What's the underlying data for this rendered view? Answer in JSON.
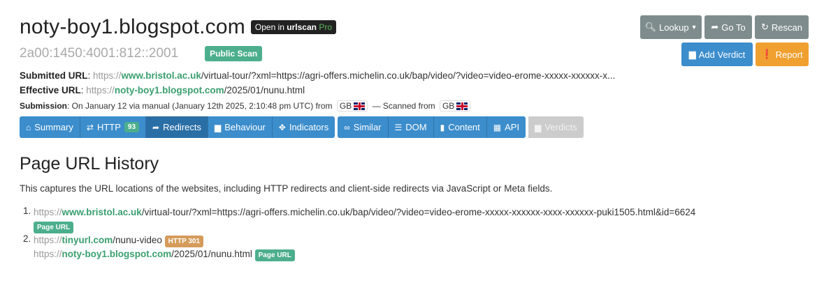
{
  "header": {
    "domain": "noty-boy1.blogspot.com",
    "open_badge_prefix": "Open in ",
    "open_badge_brand": "urlscan",
    "open_badge_pro": "Pro",
    "ip": "2a00:1450:4001:812::2001",
    "public_badge": "Public Scan"
  },
  "actions": {
    "lookup": "Lookup",
    "goto": "Go To",
    "rescan": "Rescan",
    "add_verdict": "Add Verdict",
    "report": "Report"
  },
  "submitted": {
    "label": "Submitted URL",
    "scheme": "https://",
    "host": "www.bristol.ac.uk",
    "path": "/virtual-tour/?xml=https://agri-offers.michelin.co.uk/bap/video/?video=video-erome-xxxxx-xxxxxx-x..."
  },
  "effective": {
    "label": "Effective URL",
    "scheme": "https://",
    "host": "noty-boy1.blogspot.com",
    "path": "/2025/01/nunu.html"
  },
  "submission": {
    "label": "Submission",
    "text": ": On January 12 via manual (January 12th 2025, 2:10:48 pm UTC) from",
    "country": "GB",
    "scanned_from": "— Scanned from",
    "scan_country": "GB"
  },
  "tabs": {
    "summary": "Summary",
    "http": "HTTP",
    "http_count": "93",
    "redirects": "Redirects",
    "behaviour": "Behaviour",
    "indicators": "Indicators",
    "similar": "Similar",
    "dom": "DOM",
    "content": "Content",
    "api": "API",
    "verdicts": "Verdicts"
  },
  "history": {
    "title": "Page URL History",
    "description": "This captures the URL locations of the websites, including HTTP redirects and client-side redirects via JavaScript or Meta fields.",
    "items": [
      {
        "num": "1.",
        "scheme": "https://",
        "host": "www.bristol.ac.uk",
        "path": "/virtual-tour/?xml=https://agri-offers.michelin.co.uk/bap/video/?video=video-erome-xxxxx-xxxxxx-xxxx-xxxxxx-puki1505.html&id=6624",
        "tag": "Page URL"
      },
      {
        "num": "2.",
        "scheme": "https://",
        "host": "tinyurl.com",
        "path": "/nunu-video",
        "tag": "HTTP 301",
        "scheme2": "https://",
        "host2": "noty-boy1.blogspot.com",
        "path2": "/2025/01/nunu.html",
        "tag2": "Page URL"
      }
    ]
  },
  "colors": {
    "accent_blue": "#3c8dcc",
    "green": "#4cae8c",
    "orange": "#f0a030",
    "gray_button": "#7f8c8d"
  }
}
